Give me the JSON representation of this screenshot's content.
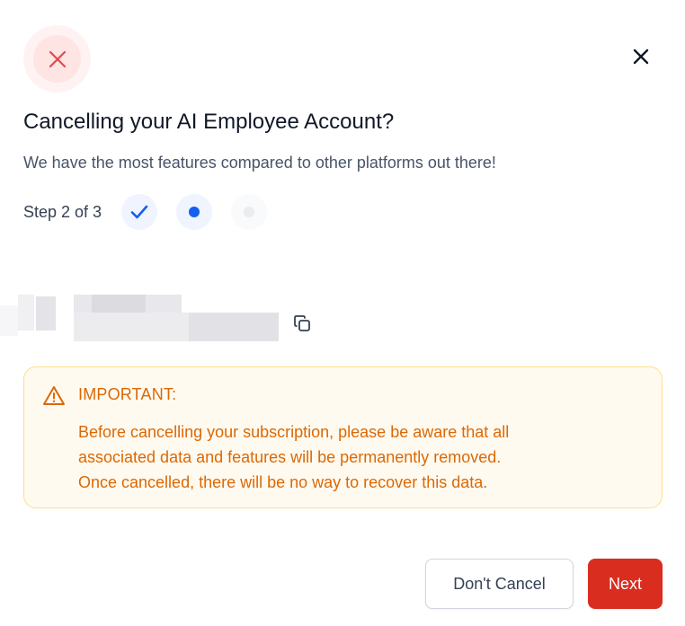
{
  "header": {
    "status_icon": "x-icon",
    "close_icon": "close-icon",
    "title": "Cancelling your AI Employee Account?",
    "subtitle": "We have the most features compared to other platforms out there!"
  },
  "steps": {
    "label": "Step 2 of 3",
    "items": [
      {
        "state": "completed",
        "icon": "check-icon"
      },
      {
        "state": "current",
        "icon": "dot-icon"
      },
      {
        "state": "upcoming",
        "icon": "dot-icon"
      }
    ]
  },
  "account": {
    "copy_icon": "copy-icon"
  },
  "alert": {
    "icon": "warning-icon",
    "title": "IMPORTANT:",
    "lines": [
      "Before cancelling your subscription, please be aware that all",
      "associated data and features will be permanently removed.",
      "Once cancelled, there will be no way to recover this data."
    ]
  },
  "actions": {
    "secondary_label": "Don't Cancel",
    "primary_label": "Next"
  },
  "colors": {
    "danger": "#d92d20",
    "accent_blue": "#155eef",
    "warning_text": "#dc6803",
    "warning_bg": "#fffaf0",
    "warning_border": "#fedf89"
  }
}
